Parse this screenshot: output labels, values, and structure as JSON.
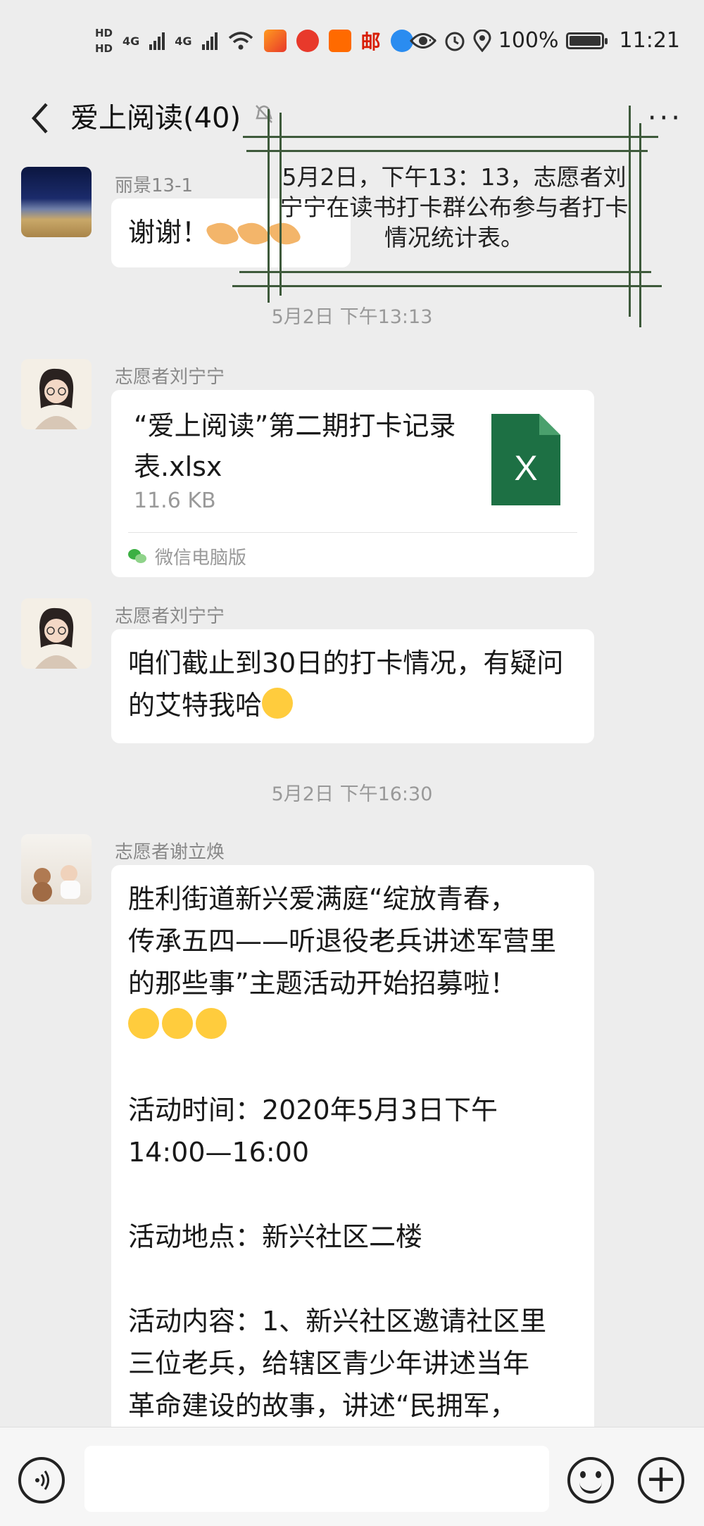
{
  "status_bar": {
    "hd1": "HD",
    "hd2": "HD",
    "signal1": "4G",
    "signal2": "4G",
    "battery_percent": "100%",
    "time": "11:21",
    "more_icons": "···",
    "mail_app_label": "邮"
  },
  "header": {
    "back_icon": "chevron-left-icon",
    "title": "爱上阅读(40)",
    "more_label": "···"
  },
  "annotation": {
    "text": "5月2日，下午13：13，志愿者刘宁宁在读书打卡群公布参与者打卡情况统计表。",
    "line_color": "#3e5a3b"
  },
  "messages": {
    "msg1": {
      "sender": "丽景13-1",
      "text": "谢谢！"
    },
    "ts1": "5月2日 下午13:13",
    "msg2": {
      "sender": "志愿者刘宁宁",
      "file_name": "“爱上阅读”第二期打卡记录表.xlsx",
      "file_size": "11.6 KB",
      "file_icon_label": "X",
      "source": "微信电脑版"
    },
    "msg3": {
      "sender": "志愿者刘宁宁",
      "text": "咱们截止到30日的打卡情况，有疑问的艾特我哈"
    },
    "ts2": "5月2日 下午16:30",
    "msg4": {
      "sender": "志愿者谢立焕",
      "line1": "胜利街道新兴爱满庭“绽放青春，",
      "line2": "传承五四——听退役老兵讲述军营里",
      "line3": "的那些事”主题活动开始招募啦！",
      "time_line1": "活动时间：2020年5月3日下午",
      "time_line2": "14:00—16:00",
      "place_line": "活动地点：新兴社区二楼",
      "content_line1": "活动内容：1、新兴社区邀请社区里",
      "content_line2": "三位老兵，给辖区青少年讲述当年",
      "content_line3": "革命建设的故事，讲述“民拥军，"
    }
  },
  "bottom_bar": {
    "voice_label": "◁)",
    "plus_label": "+"
  },
  "colors": {
    "background": "#ededed",
    "bubble": "#ffffff",
    "excel_green": "#1d7044",
    "wechat_green": "#3cb043"
  }
}
